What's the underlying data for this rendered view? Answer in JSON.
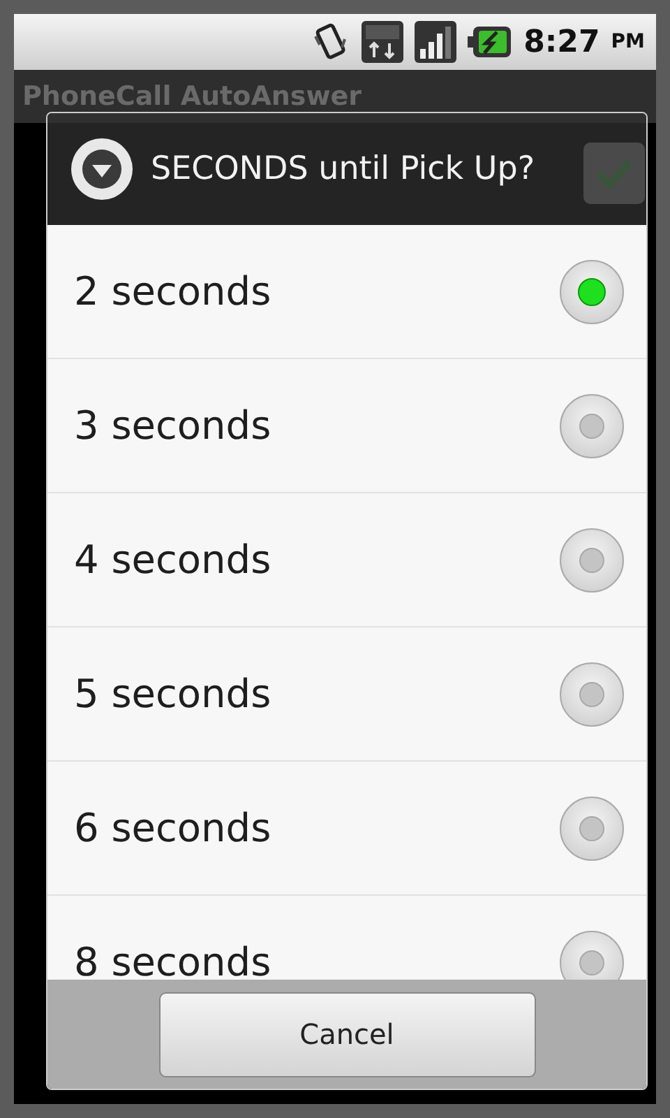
{
  "status_bar": {
    "time": "8:27",
    "ampm": "PM"
  },
  "app_bar": {
    "title": "PhoneCall AutoAnswer"
  },
  "background_row": {
    "checked": true
  },
  "dialog": {
    "title": "SECONDS until Pick Up?",
    "options": [
      {
        "label": "2 seconds",
        "selected": true
      },
      {
        "label": "3 seconds",
        "selected": false
      },
      {
        "label": "4 seconds",
        "selected": false
      },
      {
        "label": "5 seconds",
        "selected": false
      },
      {
        "label": "6 seconds",
        "selected": false
      },
      {
        "label": "8 seconds",
        "selected": false
      }
    ],
    "buttons": [
      "Cancel"
    ]
  }
}
